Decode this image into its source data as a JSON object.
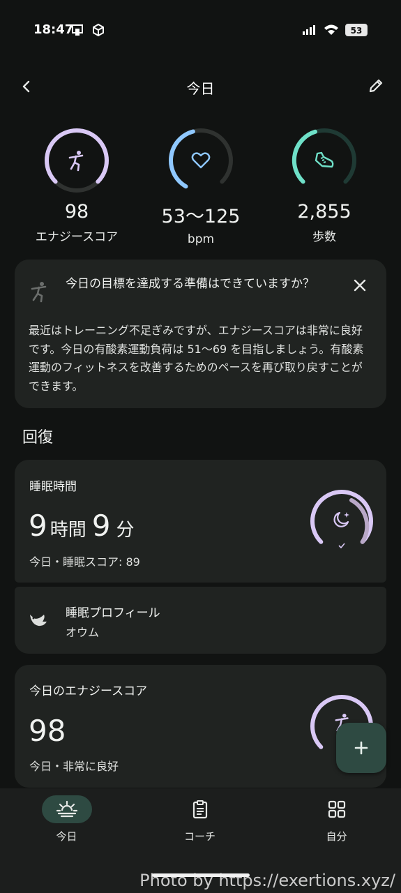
{
  "status_bar": {
    "time": "18:47",
    "battery": "53"
  },
  "header": {
    "title": "今日"
  },
  "metrics": [
    {
      "value": "98",
      "label": "エナジースコア",
      "icon": "energy-figure-icon",
      "color": "#d9c8f5"
    },
    {
      "value": "53〜125",
      "label": "bpm",
      "icon": "heart-icon",
      "color": "#8fc8ff"
    },
    {
      "value": "2,855",
      "label": "歩数",
      "icon": "shoe-icon",
      "color": "#6fe0c8"
    }
  ],
  "insight_card": {
    "title": "今日の目標を達成する準備はできていますか？",
    "body": "最近はトレーニング不足ぎみですが、エナジースコアは非常に良好です。今日の有酸素運動負荷は 51〜69 を目指しましょう。有酸素運動のフィットネスを改善するためのペースを再び取り戻すことができます。"
  },
  "recovery": {
    "section_title": "回復",
    "sleep": {
      "label": "睡眠時間",
      "hours": "9",
      "hours_unit": "時間",
      "minutes": "9",
      "minutes_unit": "分",
      "sub": "今日・睡眠スコア: 89",
      "score": 89
    },
    "sleep_profile": {
      "title": "睡眠プロフィール",
      "value": "オウム"
    },
    "energy": {
      "label": "今日のエナジースコア",
      "value": "98",
      "sub": "今日・非常に良好"
    }
  },
  "nav": [
    {
      "label": "今日",
      "icon": "sunrise-icon",
      "active": true
    },
    {
      "label": "コーチ",
      "icon": "clipboard-icon",
      "active": false
    },
    {
      "label": "自分",
      "icon": "grid-icon",
      "active": false
    }
  ],
  "watermark": "Photo by https://exertions.xyz/",
  "colors": {
    "background": "#111312",
    "card": "#202321",
    "accent_purple": "#d9c8f5",
    "accent_blue": "#8fc8ff",
    "accent_teal": "#6fe0c8",
    "fab": "#2e4a42"
  }
}
